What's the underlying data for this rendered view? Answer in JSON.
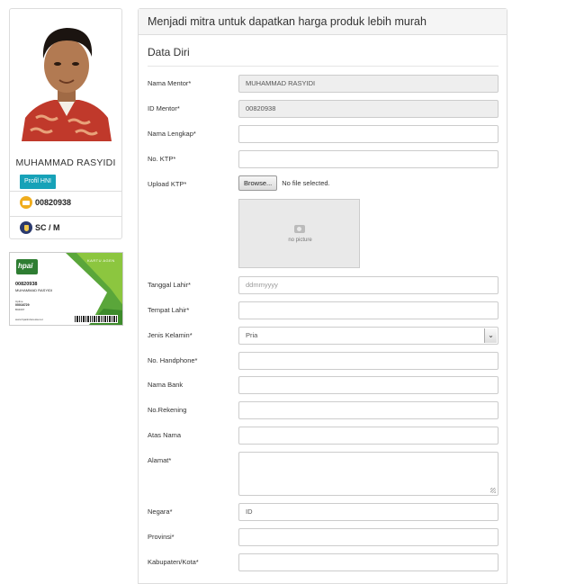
{
  "profile": {
    "name": "MUHAMMAD RASYIDI",
    "profile_button": "Profil HNI",
    "mentor_id": "00820938",
    "level": "SC / M"
  },
  "member_card": {
    "brand": "hpai",
    "card_title": "KARTU AGEN",
    "id": "00820938",
    "name": "MUHAMMAD RASYIDI",
    "sub_label": "Upline",
    "sub_id": "00016729",
    "sub_code": "B04697",
    "website": "www.hpaiindonesia.net"
  },
  "panel": {
    "title": "Menjadi mitra untuk dapatkan harga produk lebih murah",
    "section": "Data Diri"
  },
  "form": {
    "nama_mentor": {
      "label": "Nama Mentor*",
      "value": "MUHAMMAD RASYIDI"
    },
    "id_mentor": {
      "label": "ID Mentor*",
      "value": "00820938"
    },
    "nama_lengkap": {
      "label": "Nama Lengkap*",
      "value": ""
    },
    "no_ktp": {
      "label": "No. KTP*",
      "value": ""
    },
    "upload_ktp": {
      "label": "Upload KTP*",
      "button": "Browse...",
      "status": "No file selected.",
      "preview": "no picture"
    },
    "tanggal_lahir": {
      "label": "Tanggal Lahir*",
      "placeholder": "ddmmyyyy"
    },
    "tempat_lahir": {
      "label": "Tempat Lahir*",
      "value": ""
    },
    "jenis_kelamin": {
      "label": "Jenis Kelamin*",
      "value": "Pria"
    },
    "no_handphone": {
      "label": "No. Handphone*",
      "value": ""
    },
    "nama_bank": {
      "label": "Nama Bank",
      "value": ""
    },
    "no_rekening": {
      "label": "No.Rekening",
      "value": ""
    },
    "atas_nama": {
      "label": "Atas Nama",
      "value": ""
    },
    "alamat": {
      "label": "Alamat*",
      "value": ""
    },
    "negara": {
      "label": "Negara*",
      "value": "ID"
    },
    "provinsi": {
      "label": "Provinsi*",
      "value": ""
    },
    "kabupaten": {
      "label": "Kabupaten/Kota*",
      "value": ""
    }
  },
  "colors": {
    "profile_button": "#17a2b8",
    "readonly_bg": "#eeeeee",
    "header_bg": "#f5f5f5"
  },
  "icons": [
    "mail-icon",
    "badge-icon",
    "camera-icon",
    "chevron-down-icon"
  ]
}
